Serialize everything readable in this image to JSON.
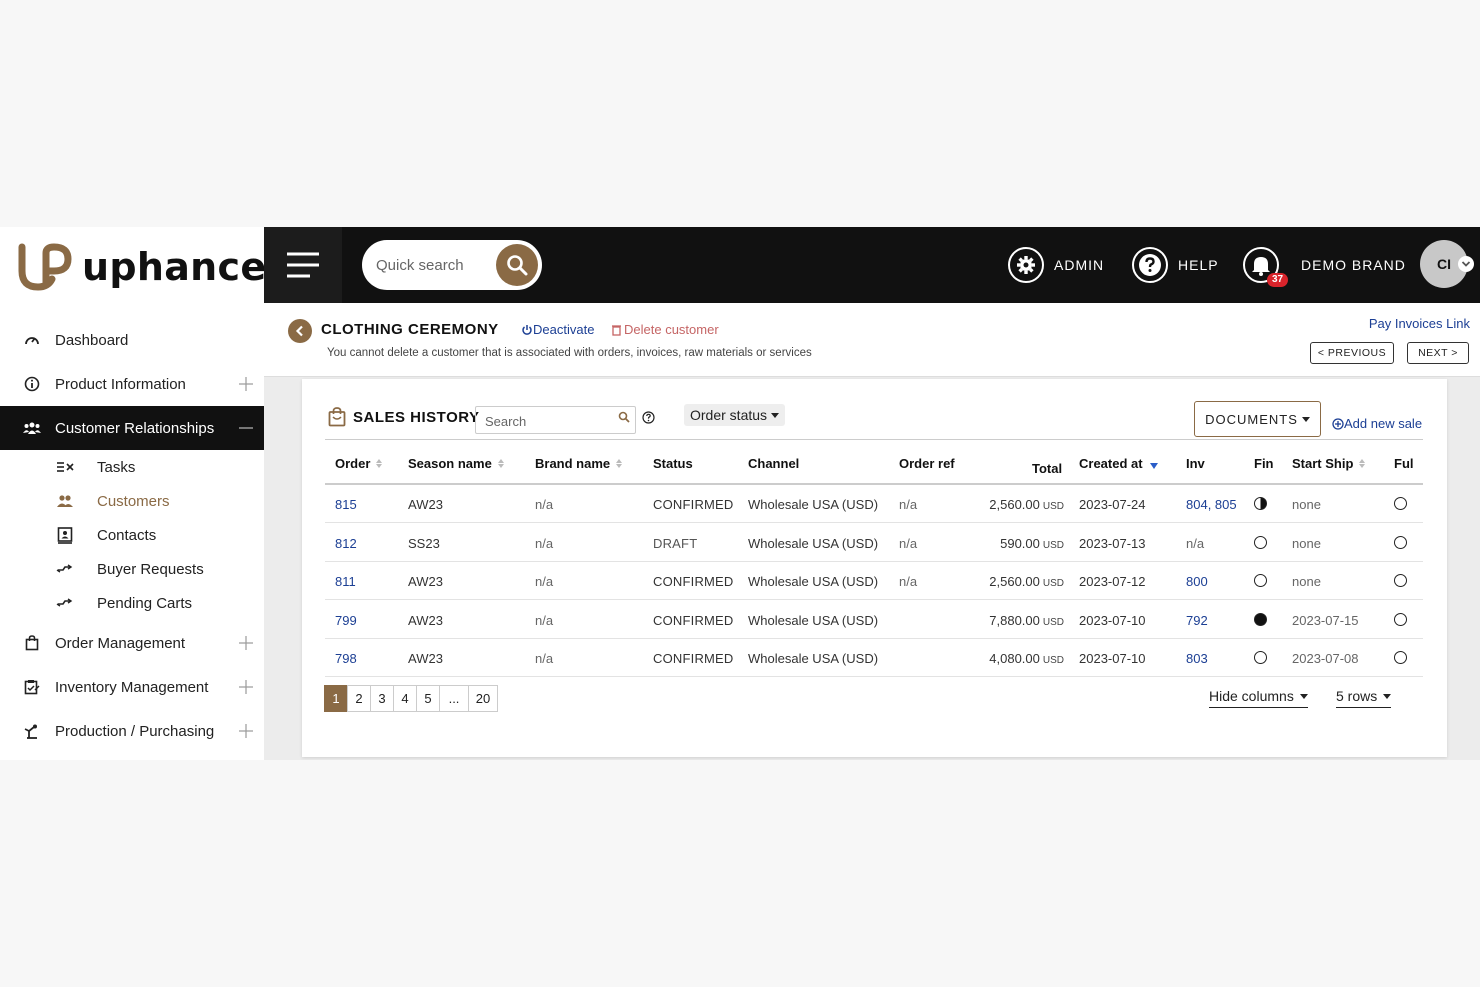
{
  "brand": {
    "name": "uphance",
    "accent": "#8a6a45"
  },
  "topbar": {
    "search_placeholder": "Quick search",
    "admin_label": "ADMIN",
    "help_label": "HELP",
    "notifications_count": "37",
    "brand_label": "DEMO BRAND",
    "avatar_initials": "CI"
  },
  "sidebar": {
    "items": [
      {
        "label": "Dashboard",
        "icon": "gauge-icon"
      },
      {
        "label": "Product Information",
        "icon": "info-icon"
      },
      {
        "label": "Customer Relationships",
        "icon": "users-icon",
        "active": true
      },
      {
        "label": "Order Management",
        "icon": "bag-icon"
      },
      {
        "label": "Inventory Management",
        "icon": "clipboard-icon"
      },
      {
        "label": "Production / Purchasing",
        "icon": "machine-icon"
      }
    ],
    "subitems": [
      {
        "label": "Tasks",
        "icon": "tasks-icon"
      },
      {
        "label": "Customers",
        "icon": "customers-icon",
        "current": true
      },
      {
        "label": "Contacts",
        "icon": "contacts-icon"
      },
      {
        "label": "Buyer Requests",
        "icon": "requests-icon"
      },
      {
        "label": "Pending Carts",
        "icon": "carts-icon"
      }
    ]
  },
  "customer": {
    "name": "CLOTHING CEREMONY",
    "deactivate_label": "Deactivate",
    "delete_label": "Delete customer",
    "note": "You cannot delete a customer that is associated with orders, invoices, raw materials or services",
    "pay_invoices_label": "Pay Invoices Link",
    "previous_label": "< PREVIOUS",
    "next_label": "NEXT >"
  },
  "sales_history": {
    "title": "SALES HISTORY",
    "search_placeholder": "Search",
    "order_status_label": "Order status",
    "documents_label": "DOCUMENTS",
    "add_new_label": "Add new sale",
    "columns": [
      "Order",
      "Season name",
      "Brand name",
      "Status",
      "Channel",
      "Order ref",
      "Total",
      "Created at",
      "Inv",
      "Fin",
      "Start Ship",
      "Ful"
    ],
    "currency_suffix": "USD",
    "rows": [
      {
        "order": "815",
        "season": "AW23",
        "brand": "n/a",
        "status": "CONFIRMED",
        "channel": "Wholesale USA (USD)",
        "order_ref": "n/a",
        "total": "2,560.00",
        "created": "2023-07-24",
        "inv": "804, 805",
        "fin": "half",
        "start_ship": "none",
        "ful": "empty"
      },
      {
        "order": "812",
        "season": "SS23",
        "brand": "n/a",
        "status": "DRAFT",
        "channel": "Wholesale USA (USD)",
        "order_ref": "n/a",
        "total": "590.00",
        "created": "2023-07-13",
        "inv": "n/a",
        "fin": "empty",
        "start_ship": "none",
        "ful": "empty"
      },
      {
        "order": "811",
        "season": "AW23",
        "brand": "n/a",
        "status": "CONFIRMED",
        "channel": "Wholesale USA (USD)",
        "order_ref": "n/a",
        "total": "2,560.00",
        "created": "2023-07-12",
        "inv": "800",
        "fin": "empty",
        "start_ship": "none",
        "ful": "empty"
      },
      {
        "order": "799",
        "season": "AW23",
        "brand": "n/a",
        "status": "CONFIRMED",
        "channel": "Wholesale USA (USD)",
        "order_ref": "",
        "total": "7,880.00",
        "created": "2023-07-10",
        "inv": "792",
        "fin": "full",
        "start_ship": "2023-07-15",
        "ful": "empty"
      },
      {
        "order": "798",
        "season": "AW23",
        "brand": "n/a",
        "status": "CONFIRMED",
        "channel": "Wholesale USA (USD)",
        "order_ref": "",
        "total": "4,080.00",
        "created": "2023-07-10",
        "inv": "803",
        "fin": "empty",
        "start_ship": "2023-07-08",
        "ful": "empty"
      }
    ],
    "pagination": {
      "pages": [
        "1",
        "2",
        "3",
        "4",
        "5",
        "...",
        "20"
      ],
      "current": "1"
    },
    "hide_columns_label": "Hide columns",
    "rows_per_page_label": "5 rows"
  }
}
